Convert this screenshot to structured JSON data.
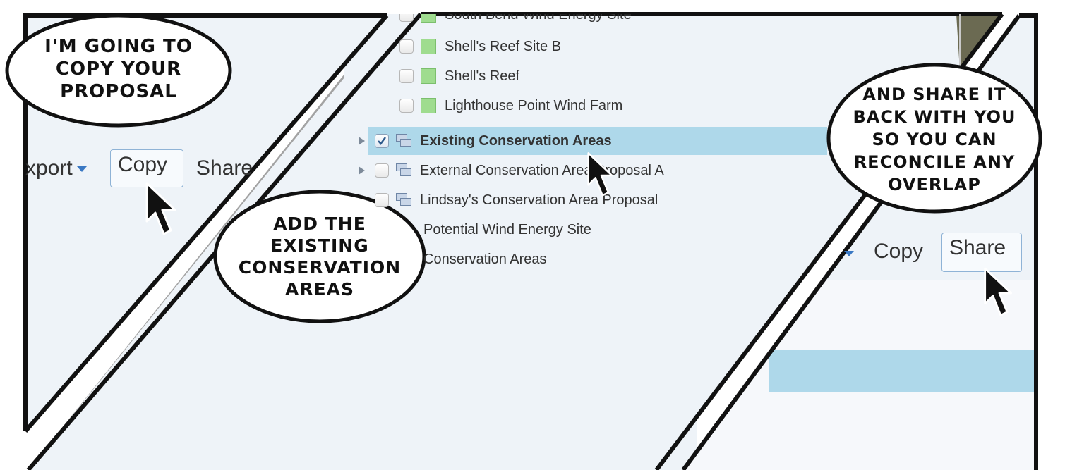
{
  "panel_left": {
    "toolbar": {
      "export_label": "xport",
      "copy_label": "Copy",
      "share_label": "Share"
    },
    "speech_bubble": {
      "lines": [
        "I'M GOING TO",
        "COPY YOUR",
        "PROPOSAL"
      ]
    }
  },
  "panel_middle": {
    "layers": {
      "items": [
        {
          "label": "South Bend Wind Energy Site",
          "checked": false
        },
        {
          "label": "Shell's Reef Site B",
          "checked": false
        },
        {
          "label": "Shell's Reef",
          "checked": false
        },
        {
          "label": "Lighthouse Point Wind Farm",
          "checked": false
        }
      ],
      "groups": [
        {
          "label": "Existing Conservation Areas",
          "checked": true,
          "selected": true
        },
        {
          "label": "External Conservation Area Proposal A",
          "checked": false
        },
        {
          "label": "Lindsay's Conservation Area Proposal",
          "checked": false
        },
        {
          "label": "Potential Wind Energy Site",
          "checked": false
        },
        {
          "label": "Conservation Areas",
          "checked": false
        }
      ]
    },
    "speech_bubble": {
      "lines": [
        "ADD THE",
        "EXISTING",
        "CONSERVATION",
        "AREAS"
      ]
    }
  },
  "panel_right": {
    "toolbar": {
      "copy_label": "Copy",
      "share_label": "Share"
    },
    "speech_bubble": {
      "lines": [
        "AND SHARE IT",
        "BACK WITH YOU",
        "SO YOU CAN",
        "RECONCILE ANY",
        "OVERLAP"
      ]
    }
  },
  "colors": {
    "ui_background": "#eef3f8",
    "selection": "#aed8ea",
    "gutter_gray": "#a3a3a3",
    "button_border": "#8fb3d6",
    "caret_blue": "#3a78c3"
  },
  "icons": [
    "cursor-arrow-icon",
    "checkbox-icon",
    "layer-stack-icon",
    "expand-triangle-icon",
    "green-swatch-icon"
  ]
}
